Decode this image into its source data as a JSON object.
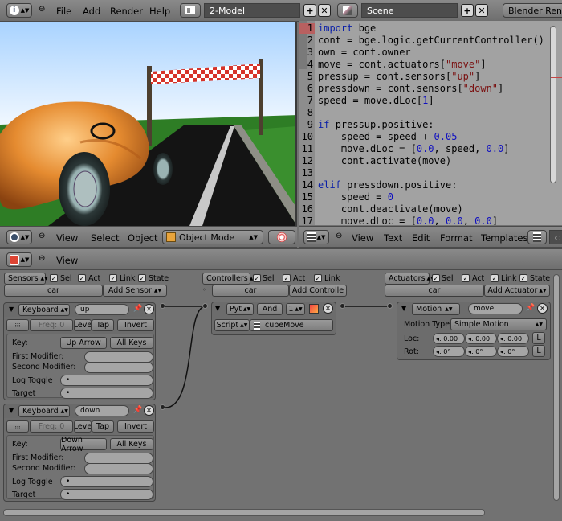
{
  "top_header": {
    "info_icon": "info-icon",
    "menus": [
      "File",
      "Add",
      "Render",
      "Help"
    ],
    "layout_name": "2-Model",
    "scene_name": "Scene",
    "engine": "Blender Rend"
  },
  "viewport_header": {
    "menus": [
      "View",
      "Select",
      "Object"
    ],
    "mode": "Object Mode"
  },
  "text_editor": {
    "menus": [
      "View",
      "Text",
      "Edit",
      "Format",
      "Templates"
    ],
    "filename_partial": "c",
    "line_numbers": [
      "1",
      "2",
      "3",
      "4",
      "5",
      "6",
      "7",
      "8",
      "9",
      "10",
      "11",
      "12",
      "13",
      "14",
      "15",
      "16",
      "17"
    ],
    "lines": [
      "import bge",
      "cont = bge.logic.getCurrentController()",
      "own = cont.owner",
      "move = cont.actuators[\"move\"]",
      "pressup = cont.sensors[\"up\"]",
      "pressdown = cont.sensors[\"down\"]",
      "speed = move.dLoc[1]",
      "",
      "if pressup.positive:",
      "    speed = speed + 0.05",
      "    move.dLoc = [0.0, speed, 0.0]",
      "    cont.activate(move)",
      "",
      "elif pressdown.positive:",
      "    speed = 0",
      "    cont.deactivate(move)",
      "    move.dLoc = [0.0, 0.0, 0.0]"
    ]
  },
  "logic_header": {
    "menus": [
      "View"
    ]
  },
  "sensors": {
    "title": "Sensors",
    "filters": [
      "Sel",
      "Act",
      "Link",
      "State"
    ],
    "object": "car",
    "add_label": "Add Sensor",
    "items": [
      {
        "type": "Keyboard",
        "name": "up",
        "freq_label": "Freq: 0",
        "level": "Leve",
        "tap": "Tap",
        "invert": "Invert",
        "key_label": "Key:",
        "key_value": "Up Arrow",
        "all_keys": "All Keys",
        "first_mod": "First Modifier:",
        "second_mod": "Second Modifier:",
        "log_toggle": "Log Toggle",
        "target": "Target"
      },
      {
        "type": "Keyboard",
        "name": "down",
        "freq_label": "Freq: 0",
        "level": "Leve",
        "tap": "Tap",
        "invert": "Invert",
        "key_label": "Key:",
        "key_value": "Down Arrow",
        "all_keys": "All Keys",
        "first_mod": "First Modifier:",
        "second_mod": "Second Modifier:",
        "log_toggle": "Log Toggle",
        "target": "Target"
      }
    ]
  },
  "controllers": {
    "title": "Controllers",
    "filters": [
      "Sel",
      "Act",
      "Link"
    ],
    "object": "car",
    "add_label": "Add Controlle",
    "item": {
      "type": "Pyt",
      "name": "And",
      "state": "1",
      "mode": "Script",
      "script": "cubeMove"
    }
  },
  "actuators": {
    "title": "Actuators",
    "filters": [
      "Sel",
      "Act",
      "Link",
      "State"
    ],
    "object": "car",
    "add_label": "Add Actuator",
    "item": {
      "type": "Motion",
      "name": "move",
      "motion_type_label": "Motion Type:",
      "motion_type": "Simple Motion",
      "loc_label": "Loc:",
      "rot_label": "Rot:",
      "loc_values": [
        "0.00",
        "0.00",
        "0.00"
      ],
      "rot_values": [
        "0°",
        "0°",
        "0°"
      ],
      "local": "L"
    }
  }
}
